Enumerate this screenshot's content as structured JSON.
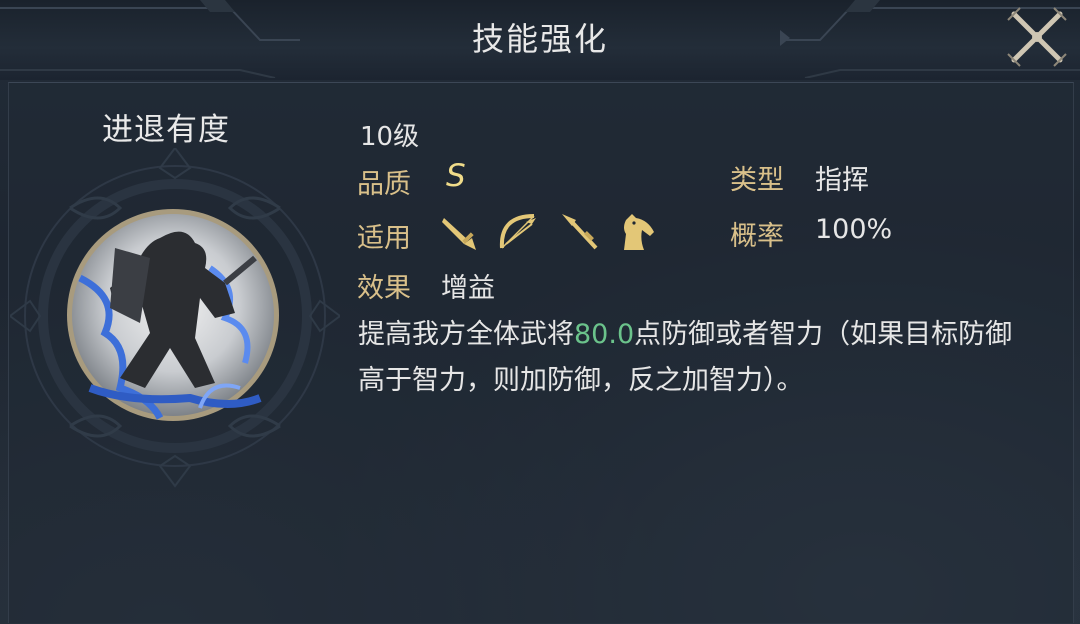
{
  "header": {
    "title": "技能强化",
    "close_icon": "close-crossed-swords-icon"
  },
  "skill": {
    "name": "进退有度",
    "emblem_icon": "warrior-lightning-emblem-icon",
    "level": "10级",
    "quality_label": "品质",
    "quality_value": "S",
    "type_label": "类型",
    "type_value": "指挥",
    "applicable_label": "适用",
    "applicable_units": [
      {
        "name": "sword-icon",
        "unit": "infantry"
      },
      {
        "name": "bow-icon",
        "unit": "archer"
      },
      {
        "name": "spear-icon",
        "unit": "spearman"
      },
      {
        "name": "horse-icon",
        "unit": "cavalry"
      }
    ],
    "rate_label": "概率",
    "rate_value": "100%",
    "effect_label": "效果",
    "effect_value": "增益",
    "description": {
      "before": "提高我方全体武将",
      "highlight": "80.0",
      "after": "点防御或者智力（如果目标防御高于智力，则加防御，反之加智力）。"
    }
  },
  "colors": {
    "background": "#1f2833",
    "label_gold": "#d9c08a",
    "highlight_green": "#6bc38b",
    "text": "#e6e6e6"
  }
}
